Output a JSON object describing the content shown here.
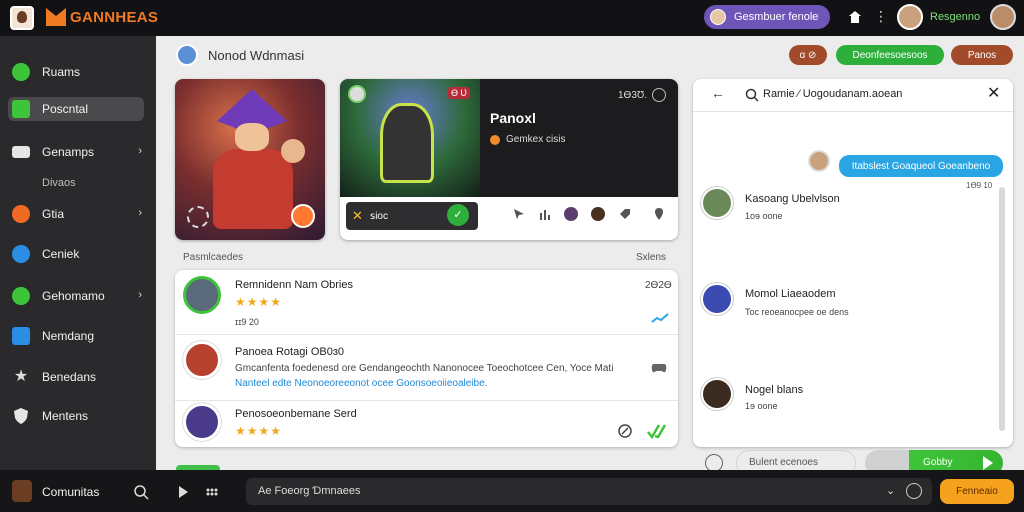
{
  "colors": {
    "accent_orange": "#f07a24",
    "accent_green": "#3ec43a",
    "accent_blue": "#2aa5e4",
    "accent_purple": "#6e56b8",
    "sidebar_bg": "#2a2a2d",
    "topbar_bg": "#121214"
  },
  "topbar": {
    "brand": "GANNHEAS",
    "pill_label": "Gesmbuer fenole",
    "home_icon": "home-icon",
    "user_name": "Resgenno"
  },
  "sidebar": {
    "items": [
      {
        "label": "Ruams",
        "icon": "green-circle-icon"
      },
      {
        "label": "Poscntal",
        "icon": "green-square-icon"
      },
      {
        "label": "Genamps",
        "icon": "card-icon"
      },
      {
        "label": "Gtia",
        "icon": "orange-circle-icon"
      },
      {
        "label": "Ceniek",
        "icon": "blue-circle-icon"
      },
      {
        "label": "Gehomamo",
        "icon": "green-circle-icon"
      },
      {
        "label": "Nemdang",
        "icon": "clipboard-icon"
      },
      {
        "label": "Benedans",
        "icon": "star-icon"
      },
      {
        "label": "Mentens",
        "icon": "shield-icon"
      }
    ],
    "sub_label": "Divaos"
  },
  "main": {
    "title": "Nonod Wdnmasi",
    "header_buttons": [
      {
        "label": "ɑ ⊘",
        "color": "#a24b2a"
      },
      {
        "label": "Deonfeesoesoos",
        "color": "#2eae3a"
      },
      {
        "label": "Panos",
        "color": "#a24b2a"
      }
    ],
    "hero": {
      "tag": "Ɵ Ʋ",
      "title": "Panoxl",
      "subtitle": "Gemkex cisis",
      "number": "1Ɵ3Ʊ.",
      "bar_label": "ꜱioc",
      "go_icon": "check-icon"
    },
    "section_left": "Pasmlcaedes",
    "section_right": "Sxlens",
    "rows": [
      {
        "title": "Remnidenn Nam Obries",
        "stars": "★★★★",
        "meta": "ɪɪ9 20",
        "right": "2Ɵ2Ɵ"
      },
      {
        "title": "Panoea Rotagi OB0ɜ0",
        "line1": "Gmcanfenta foedenesd ore Gendangeochth Nanonocee Toeochotcee Cen, Yoce Mati",
        "line2": "Nanteel edte Neonoeoreeonot ocee Goonsoeoiieoaleibe."
      },
      {
        "title": "Penosoeonbemane Serd",
        "stars": "★★★★"
      }
    ]
  },
  "chat": {
    "title": "Ramie ⁄ Uogoudanam.aoean",
    "bubble": "Itabslest Goaqueol Goeanbeno",
    "time": "1Ɵ9 10",
    "messages": [
      {
        "name": "Kasoang Ubelvlson",
        "sub": "1oɘ oone"
      },
      {
        "name": "Momol Liaeaodem",
        "sub": "Toc reoeanocpee oe dens"
      },
      {
        "name": "Nogel blans",
        "sub": "1ɘ oone"
      }
    ],
    "input_placeholder": "Bulent ecenoes",
    "send_label": "Gobby"
  },
  "bottombar": {
    "label": "Comunitas",
    "input_placeholder": "Ae Foeorg Ɗmnaees",
    "button_label": "Fenneaio"
  }
}
